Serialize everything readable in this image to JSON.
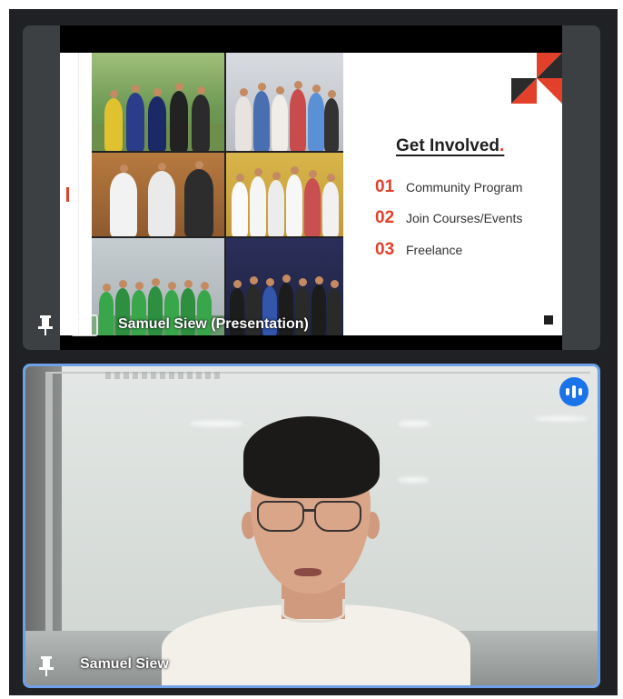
{
  "meeting": {
    "presentation_tile": {
      "name_label": "Samuel Siew (Presentation)",
      "pin_icon": "pin-icon",
      "present_icon": "present-to-all-icon"
    },
    "camera_tile": {
      "name_label": "Samuel Siew",
      "pin_icon": "pin-icon",
      "audio_icon": "audio-level-icon",
      "active_speaker_border_color": "#6fa0e8"
    }
  },
  "slide": {
    "title": "Get Involved",
    "title_dot": ".",
    "accent_color": "#e2402b",
    "items": [
      {
        "number": "01",
        "text": "Community Program"
      },
      {
        "number": "02",
        "text": "Join Courses/Events"
      },
      {
        "number": "03",
        "text": "Freelance"
      }
    ]
  }
}
